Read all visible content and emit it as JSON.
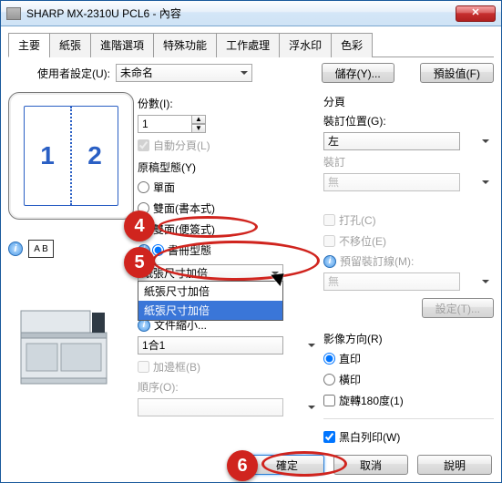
{
  "window": {
    "title": "SHARP MX-2310U PCL6 - 內容",
    "close": "✕"
  },
  "tabs": [
    "主要",
    "紙張",
    "進階選項",
    "特殊功能",
    "工作處理",
    "浮水印",
    "色彩"
  ],
  "topbar": {
    "user_setting_label": "使用者設定(U):",
    "user_setting_value": "未命名",
    "save_btn": "儲存(Y)...",
    "default_btn": "預設值(F)"
  },
  "mid": {
    "copies_label": "份數(I):",
    "copies_value": "1",
    "collate_label": "自動分頁(L)",
    "orig_label": "原稿型態(Y)",
    "radios": {
      "simplex": "單面",
      "duplex_book": "雙面(書本式)",
      "duplex_tablet": "雙面(便簽式)",
      "booklet": "書冊型態"
    },
    "dd": {
      "opt1": "紙張尺寸加倍",
      "opt2": "紙張尺寸加倍"
    },
    "text_below": "文件縮小...",
    "nup_value": "1合1",
    "border_label": "加邊框(B)",
    "order_label": "順序(O):"
  },
  "right": {
    "section": "分頁",
    "bind_pos_label": "裝訂位置(G):",
    "bind_pos_value": "左",
    "staple_label": "裝訂",
    "staple_value": "無",
    "punch_label": "打孔(C)",
    "noshift_label": "不移位(E)",
    "reserve_label": "預留裝訂線(M):",
    "reserve_value": "無",
    "settings_btn": "設定(T)...",
    "img_dir_label": "影像方向(R)",
    "portrait": "直印",
    "landscape": "橫印",
    "rotate": "旋轉180度(1)",
    "bw_label": "黑白列印(W)"
  },
  "footer": {
    "ok": "確定",
    "cancel": "取消",
    "help": "說明"
  },
  "badges": {
    "b4": "4",
    "b5": "5",
    "b6": "6"
  }
}
